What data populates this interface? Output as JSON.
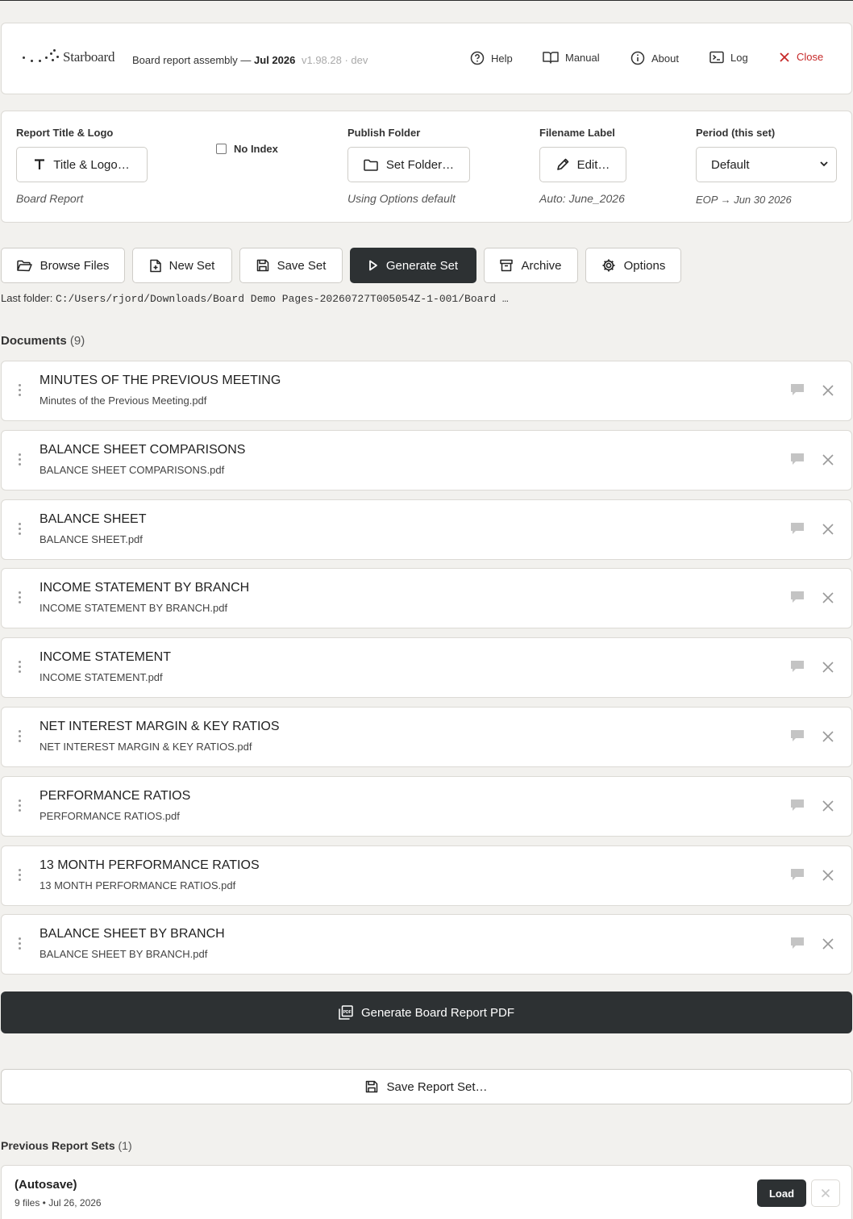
{
  "header": {
    "brand": "Starboard",
    "subtitle_prefix": "Board report assembly —",
    "subtitle_period": "Jul 2026",
    "version": "v1.98.28 · dev",
    "nav": {
      "help": "Help",
      "manual": "Manual",
      "about": "About",
      "log": "Log",
      "close": "Close"
    }
  },
  "settings": {
    "title_logo": {
      "label": "Report Title & Logo",
      "button": "Title & Logo…",
      "hint": "Board Report"
    },
    "no_index": {
      "label": "No Index",
      "checked": false
    },
    "publish_folder": {
      "label": "Publish Folder",
      "button": "Set Folder…",
      "hint": "Using Options default"
    },
    "filename_label": {
      "label": "Filename Label",
      "button": "Edit…",
      "hint": "Auto: June_2026"
    },
    "period": {
      "label": "Period (this set)",
      "selected": "Default",
      "hint": "EOP → Jun 30 2026"
    }
  },
  "toolbar": {
    "browse": "Browse Files",
    "new_set": "New Set",
    "save_set": "Save Set",
    "generate_set": "Generate Set",
    "archive": "Archive",
    "options": "Options"
  },
  "last_folder": {
    "label": "Last folder:",
    "path": "C:/Users/rjord/Downloads/Board Demo Pages-20260727T005054Z-1-001/Board …"
  },
  "documents": {
    "heading": "Documents",
    "count": "(9)",
    "items": [
      {
        "title": "MINUTES OF THE PREVIOUS MEETING",
        "file": "Minutes of the Previous Meeting.pdf"
      },
      {
        "title": "BALANCE SHEET COMPARISONS",
        "file": "BALANCE SHEET COMPARISONS.pdf"
      },
      {
        "title": "BALANCE SHEET",
        "file": "BALANCE SHEET.pdf"
      },
      {
        "title": "INCOME STATEMENT BY BRANCH",
        "file": "INCOME STATEMENT BY BRANCH.pdf"
      },
      {
        "title": "INCOME STATEMENT",
        "file": "INCOME STATEMENT.pdf"
      },
      {
        "title": "NET INTEREST MARGIN & KEY RATIOS",
        "file": "NET INTEREST MARGIN & KEY RATIOS.pdf"
      },
      {
        "title": "PERFORMANCE RATIOS",
        "file": "PERFORMANCE RATIOS.pdf"
      },
      {
        "title": "13 MONTH PERFORMANCE RATIOS",
        "file": "13 MONTH PERFORMANCE RATIOS.pdf"
      },
      {
        "title": "BALANCE SHEET BY BRANCH",
        "file": "BALANCE SHEET BY BRANCH.pdf"
      }
    ]
  },
  "actions": {
    "generate_pdf": "Generate Board Report PDF",
    "save_report_set": "Save Report Set…"
  },
  "previous_sets": {
    "heading": "Previous Report Sets",
    "count": "(1)",
    "items": [
      {
        "name": "(Autosave)",
        "meta": "9 files • Jul 26, 2026",
        "load": "Load"
      }
    ]
  },
  "colors": {
    "background": "#f2f1ee",
    "dark_button": "#2d3133",
    "close_red": "#c62828"
  },
  "icons": [
    "help-circle-icon",
    "book-icon",
    "info-icon",
    "terminal-icon",
    "close-x-icon",
    "text-t-icon",
    "folder-icon",
    "pencil-icon",
    "folder-open-icon",
    "file-plus-icon",
    "save-icon",
    "play-icon",
    "archive-icon",
    "gear-icon",
    "drag-handle-icon",
    "comment-icon",
    "pdf-icon"
  ]
}
